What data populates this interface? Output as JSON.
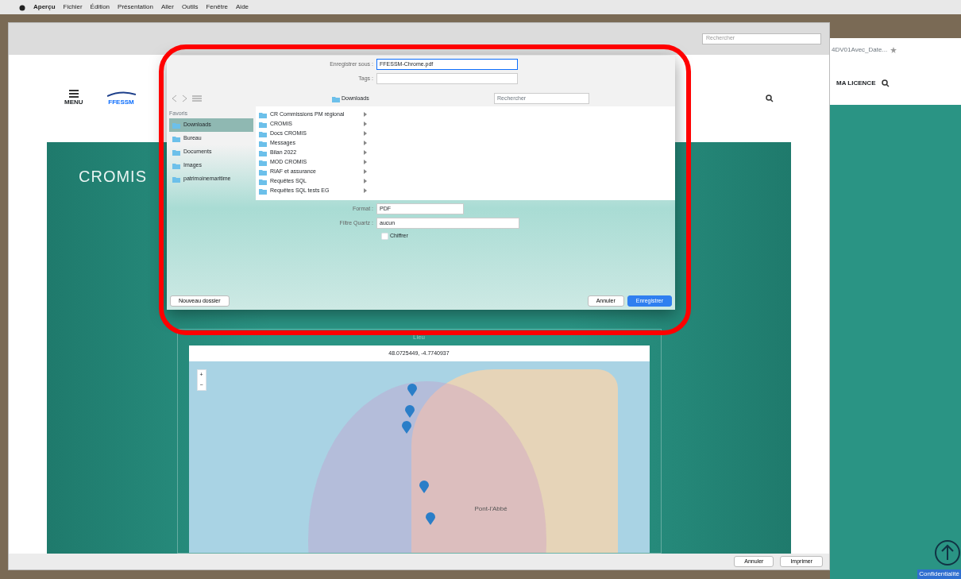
{
  "menu_bar": {
    "items": [
      "Aperçu",
      "Fichier",
      "Édition",
      "Présentation",
      "Aller",
      "Outils",
      "Fenêtre",
      "Aide"
    ]
  },
  "print_window": {
    "search_placeholder": "Rechercher"
  },
  "web_page": {
    "menu_label": "MENU",
    "brand": "FFESSM",
    "logo_text": "CROMIS",
    "map": {
      "title": "Lieu",
      "coordinates": "48.0725449, -4.7740937",
      "zoom_in": "+",
      "zoom_out": "−",
      "place_label": "Pont-l'Abbé"
    }
  },
  "print_buttons": [
    {
      "label": "Annuler"
    },
    {
      "label": "Imprimer"
    }
  ],
  "side_window": {
    "url": "4DV01Avec_Date...",
    "nav_label": "MA LICENCE",
    "badge": "Confidentialité"
  },
  "save_dialog": {
    "save_as": {
      "label": "Enregistrer sous :",
      "value": "FFESSM-Chrome.pdf"
    },
    "tags": {
      "label": "Tags :"
    },
    "location": "Downloads",
    "search_placeholder": "Rechercher",
    "sidebar": {
      "heading": "Favoris",
      "items": [
        {
          "label": "Downloads",
          "selected": true
        },
        {
          "label": "Bureau",
          "selected": false
        },
        {
          "label": "Documents",
          "selected": false
        },
        {
          "label": "Images",
          "selected": false
        },
        {
          "label": "patrimoinemaritime",
          "selected": false
        }
      ]
    },
    "files": [
      {
        "name": "CR Commissions PM régional"
      },
      {
        "name": "CROMIS"
      },
      {
        "name": "Docs CROMIS"
      },
      {
        "name": "Messages"
      },
      {
        "name": "Bilan 2022"
      },
      {
        "name": "MOD CROMIS"
      },
      {
        "name": "RIAF et assurance"
      },
      {
        "name": "Requêtes SQL"
      },
      {
        "name": "Requêtes SQL tests EG"
      }
    ],
    "format": {
      "label": "Format :",
      "value": "PDF"
    },
    "quartz": {
      "label": "Filtre Quartz :",
      "value": "aucun"
    },
    "encrypt": {
      "label": "Chiffrer",
      "checked": false
    },
    "new_folder": "Nouveau dossier",
    "buttons": [
      {
        "label": "Annuler",
        "kind": "secondary"
      },
      {
        "label": "Enregistrer",
        "kind": "primary"
      }
    ]
  }
}
